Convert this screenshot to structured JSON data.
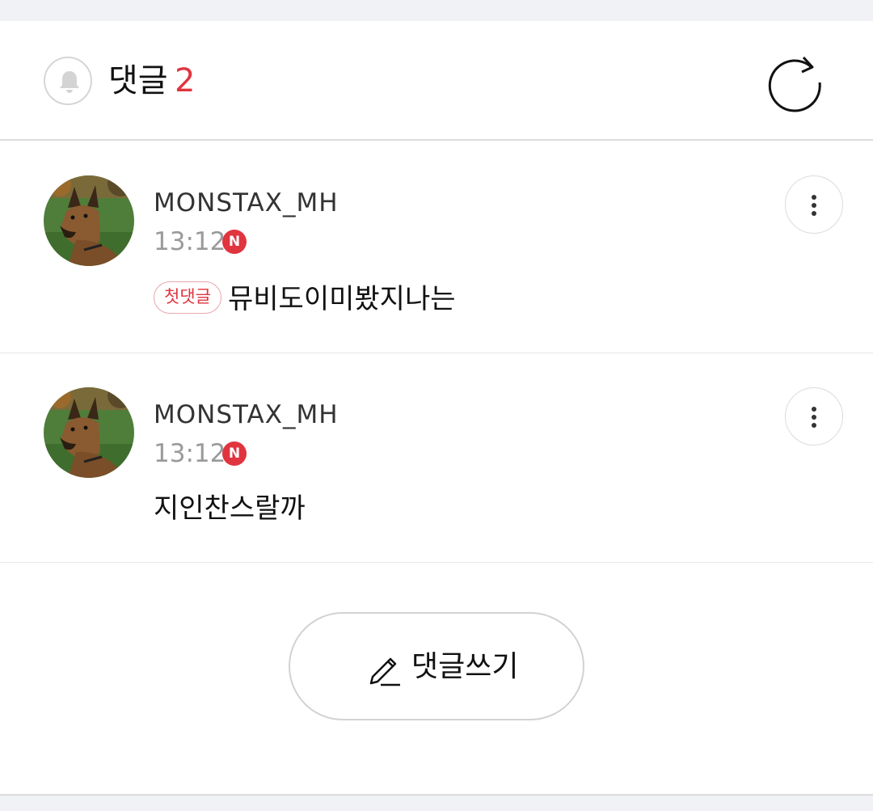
{
  "header": {
    "title": "댓글",
    "count": "2",
    "icons": {
      "notify": "bell-icon",
      "refresh": "refresh-icon"
    }
  },
  "comments": [
    {
      "username": "MONSTAX_MH",
      "time": "13:12",
      "new_badge": "N",
      "tag": "첫댓글",
      "text": "뮤비도이미봤지나는",
      "avatar": "dog-avatar"
    },
    {
      "username": "MONSTAX_MH",
      "time": "13:12",
      "new_badge": "N",
      "tag": "",
      "text": "지인찬스랄까",
      "avatar": "dog-avatar"
    }
  ],
  "write_button": {
    "label": "댓글쓰기",
    "icon": "pencil-icon"
  },
  "colors": {
    "accent_red": "#e0343f",
    "divider": "#dcdcdc",
    "band_bg": "#f1f2f5",
    "muted_text": "#9a9a9a"
  }
}
